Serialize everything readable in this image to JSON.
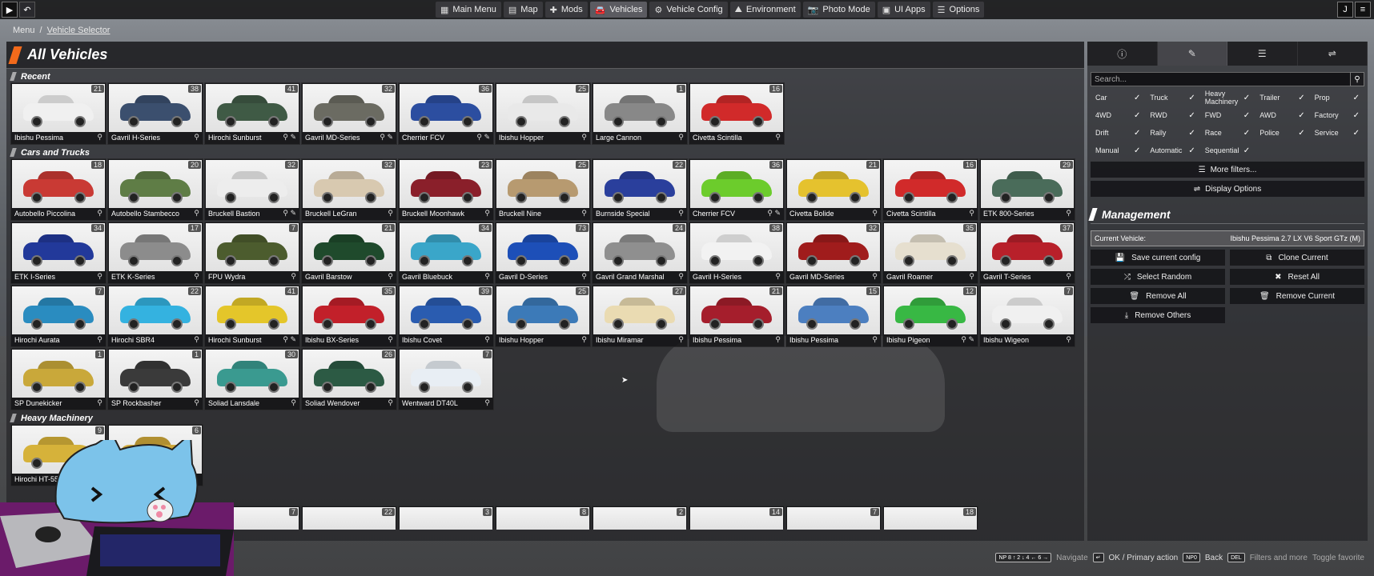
{
  "topbar": {
    "nav": [
      {
        "icon": "grid-icon",
        "glyph": "▦",
        "label": "Main Menu",
        "active": false
      },
      {
        "icon": "map-icon",
        "glyph": "▤",
        "label": "Map",
        "active": false
      },
      {
        "icon": "puzzle-icon",
        "glyph": "✚",
        "label": "Mods",
        "active": false
      },
      {
        "icon": "car-icon",
        "glyph": "🚘",
        "label": "Vehicles",
        "active": true
      },
      {
        "icon": "wrench-car-icon",
        "glyph": "⚙",
        "label": "Vehicle Config",
        "active": false
      },
      {
        "icon": "mountain-icon",
        "glyph": "⛰",
        "label": "Environment",
        "active": false
      },
      {
        "icon": "camera-icon",
        "glyph": "📷",
        "label": "Photo Mode",
        "active": false
      },
      {
        "icon": "apps-icon",
        "glyph": "▣",
        "label": "UI Apps",
        "active": false
      },
      {
        "icon": "sliders-icon",
        "glyph": "☰",
        "label": "Options",
        "active": false
      }
    ]
  },
  "breadcrumb": {
    "root": "Menu",
    "separator": "/",
    "current": "Vehicle Selector"
  },
  "panel_title": "All Vehicles",
  "sections": [
    {
      "title": "Recent",
      "vehicles": [
        {
          "name": "Ibishu Pessima",
          "count": "21",
          "tags": "⚲",
          "color": "#f0f0f0"
        },
        {
          "name": "Gavril H-Series",
          "count": "38",
          "tags": "⚲",
          "color": "#3b4f6e"
        },
        {
          "name": "Hirochi Sunburst",
          "count": "41",
          "tags": "⚲ ✎",
          "color": "#3f5a45"
        },
        {
          "name": "Gavril MD-Series",
          "count": "32",
          "tags": "⚲ ✎",
          "color": "#6b6b62"
        },
        {
          "name": "Cherrier FCV",
          "count": "36",
          "tags": "⚲ ✎",
          "color": "#2c4ea0"
        },
        {
          "name": "Ibishu Hopper",
          "count": "25",
          "tags": "⚲",
          "color": "#e9e9e9"
        },
        {
          "name": "Large Cannon",
          "count": "1",
          "tags": "⚲",
          "color": "#888888"
        },
        {
          "name": "Civetta Scintilla",
          "count": "16",
          "tags": "⚲",
          "color": "#d12a2a"
        }
      ]
    },
    {
      "title": "Cars and Trucks",
      "vehicles": [
        {
          "name": "Autobello Piccolina",
          "count": "18",
          "tags": "⚲",
          "color": "#c93a34"
        },
        {
          "name": "Autobello Stambecco",
          "count": "20",
          "tags": "⚲",
          "color": "#5f7d46"
        },
        {
          "name": "Bruckell Bastion",
          "count": "32",
          "tags": "⚲ ✎",
          "color": "#ededed"
        },
        {
          "name": "Bruckell LeGran",
          "count": "32",
          "tags": "⚲",
          "color": "#d8c9b0"
        },
        {
          "name": "Bruckell Moonhawk",
          "count": "23",
          "tags": "⚲",
          "color": "#8a1f2a"
        },
        {
          "name": "Bruckell Nine",
          "count": "25",
          "tags": "⚲",
          "color": "#b79a70"
        },
        {
          "name": "Burnside Special",
          "count": "22",
          "tags": "⚲",
          "color": "#2a3f9c"
        },
        {
          "name": "Cherrier FCV",
          "count": "36",
          "tags": "⚲ ✎",
          "color": "#6ccc2c"
        },
        {
          "name": "Civetta Bolide",
          "count": "21",
          "tags": "⚲",
          "color": "#e5c22e"
        },
        {
          "name": "Civetta Scintilla",
          "count": "16",
          "tags": "⚲",
          "color": "#d12a2a"
        },
        {
          "name": "ETK 800-Series",
          "count": "29",
          "tags": "⚲",
          "color": "#4a6c5a"
        },
        {
          "name": "ETK I-Series",
          "count": "34",
          "tags": "⚲",
          "color": "#22399a"
        },
        {
          "name": "ETK K-Series",
          "count": "17",
          "tags": "⚲",
          "color": "#8c8c8c"
        },
        {
          "name": "FPU Wydra",
          "count": "7",
          "tags": "⚲",
          "color": "#4c5c2e"
        },
        {
          "name": "Gavril Barstow",
          "count": "21",
          "tags": "⚲",
          "color": "#1f4a2c"
        },
        {
          "name": "Gavril Bluebuck",
          "count": "34",
          "tags": "⚲",
          "color": "#3aa6c9"
        },
        {
          "name": "Gavril D-Series",
          "count": "73",
          "tags": "⚲",
          "color": "#1d4fb8"
        },
        {
          "name": "Gavril Grand Marshal",
          "count": "24",
          "tags": "⚲",
          "color": "#8f8f8f"
        },
        {
          "name": "Gavril H-Series",
          "count": "38",
          "tags": "⚲",
          "color": "#f2f2f2"
        },
        {
          "name": "Gavril MD-Series",
          "count": "32",
          "tags": "⚲",
          "color": "#a01c1c"
        },
        {
          "name": "Gavril Roamer",
          "count": "35",
          "tags": "⚲",
          "color": "#e6dfcf"
        },
        {
          "name": "Gavril T-Series",
          "count": "37",
          "tags": "⚲",
          "color": "#b8202a"
        },
        {
          "name": "Hirochi Aurata",
          "count": "7",
          "tags": "⚲",
          "color": "#2a8cc0"
        },
        {
          "name": "Hirochi SBR4",
          "count": "22",
          "tags": "⚲",
          "color": "#34b2e0"
        },
        {
          "name": "Hirochi Sunburst",
          "count": "41",
          "tags": "⚲ ✎",
          "color": "#e4c62a"
        },
        {
          "name": "Ibishu BX-Series",
          "count": "35",
          "tags": "⚲",
          "color": "#c2202a"
        },
        {
          "name": "Ibishu Covet",
          "count": "39",
          "tags": "⚲",
          "color": "#2a5cb0"
        },
        {
          "name": "Ibishu Hopper",
          "count": "25",
          "tags": "⚲",
          "color": "#3c7ab8"
        },
        {
          "name": "Ibishu Miramar",
          "count": "27",
          "tags": "⚲",
          "color": "#eadbb2"
        },
        {
          "name": "Ibishu Pessima",
          "count": "21",
          "tags": "⚲",
          "color": "#a51e2c"
        },
        {
          "name": "Ibishu Pessima",
          "count": "15",
          "tags": "⚲",
          "color": "#4c7fc0"
        },
        {
          "name": "Ibishu Pigeon",
          "count": "12",
          "tags": "⚲ ✎",
          "color": "#38b844"
        },
        {
          "name": "Ibishu Wigeon",
          "count": "7",
          "tags": "⚲",
          "color": "#f0f0f0"
        },
        {
          "name": "SP Dunekicker",
          "count": "1",
          "tags": "⚲",
          "color": "#c9a83a"
        },
        {
          "name": "SP Rockbasher",
          "count": "1",
          "tags": "⚲",
          "color": "#3a3a3a"
        },
        {
          "name": "Soliad Lansdale",
          "count": "30",
          "tags": "⚲",
          "color": "#3a9a90"
        },
        {
          "name": "Soliad Wendover",
          "count": "26",
          "tags": "⚲",
          "color": "#2c5a44"
        },
        {
          "name": "Wentward DT40L",
          "count": "7",
          "tags": "⚲",
          "color": "#e8eef4"
        }
      ]
    },
    {
      "title": "Heavy Machinery",
      "vehicles": [
        {
          "name": "Hirochi HT-55",
          "count": "9",
          "tags": "",
          "color": "#d6b23a"
        },
        {
          "name": "",
          "count": "6",
          "tags": "",
          "color": "#cfa83a"
        }
      ]
    }
  ],
  "partial_row_counts": [
    "11",
    "13",
    "7",
    "22",
    "3",
    "8",
    "2",
    "14",
    "7",
    "18"
  ],
  "side": {
    "tabs": [
      {
        "icon": "info-icon",
        "glyph": "ⓘ",
        "active": false
      },
      {
        "icon": "paint-icon",
        "glyph": "✎",
        "active": true
      },
      {
        "icon": "filter-icon",
        "glyph": "☰",
        "active": false
      },
      {
        "icon": "sliders-icon",
        "glyph": "⇌",
        "active": false
      }
    ],
    "search_placeholder": "Search...",
    "filters": [
      {
        "label": "Car",
        "checked": true
      },
      {
        "label": "Truck",
        "checked": true
      },
      {
        "label": "Heavy Machinery",
        "checked": true
      },
      {
        "label": "Trailer",
        "checked": true
      },
      {
        "label": "Prop",
        "checked": true
      },
      {
        "label": "4WD",
        "checked": true
      },
      {
        "label": "RWD",
        "checked": true
      },
      {
        "label": "FWD",
        "checked": true
      },
      {
        "label": "AWD",
        "checked": true
      },
      {
        "label": "Factory",
        "checked": true
      },
      {
        "label": "Drift",
        "checked": true
      },
      {
        "label": "Rally",
        "checked": true
      },
      {
        "label": "Race",
        "checked": true
      },
      {
        "label": "Police",
        "checked": true
      },
      {
        "label": "Service",
        "checked": true
      },
      {
        "label": "Manual",
        "checked": true
      },
      {
        "label": "Automatic",
        "checked": true
      },
      {
        "label": "Sequential",
        "checked": true
      }
    ],
    "more_filters": "More filters...",
    "display_options": "Display Options",
    "management_title": "Management",
    "current_vehicle_label": "Current Vehicle:",
    "current_vehicle_value": "Ibishu Pessima 2.7 LX V6 Sport GTz (M)",
    "buttons": [
      {
        "glyph": "💾",
        "icon": "save-icon",
        "label": "Save current config"
      },
      {
        "glyph": "⧉",
        "icon": "clone-icon",
        "label": "Clone Current"
      },
      {
        "glyph": "⤮",
        "icon": "shuffle-icon",
        "label": "Select Random"
      },
      {
        "glyph": "✖",
        "icon": "reset-icon",
        "label": "Reset All"
      },
      {
        "glyph": "🗑",
        "icon": "trash-icon",
        "label": "Remove All"
      },
      {
        "glyph": "🗑",
        "icon": "trash-icon",
        "label": "Remove Current"
      },
      {
        "glyph": "⤓",
        "icon": "remove-others-icon",
        "label": "Remove Others"
      }
    ]
  },
  "bottom_hints": {
    "navigate_key": "NP 8 ↑ 2 ↓ 4 ← 6 →",
    "navigate": "Navigate",
    "ok": "OK / Primary action",
    "back_key": "NP0",
    "back": "Back",
    "del_key": "DEL",
    "filters": "Filters and more",
    "favorite": "Toggle favorite"
  }
}
